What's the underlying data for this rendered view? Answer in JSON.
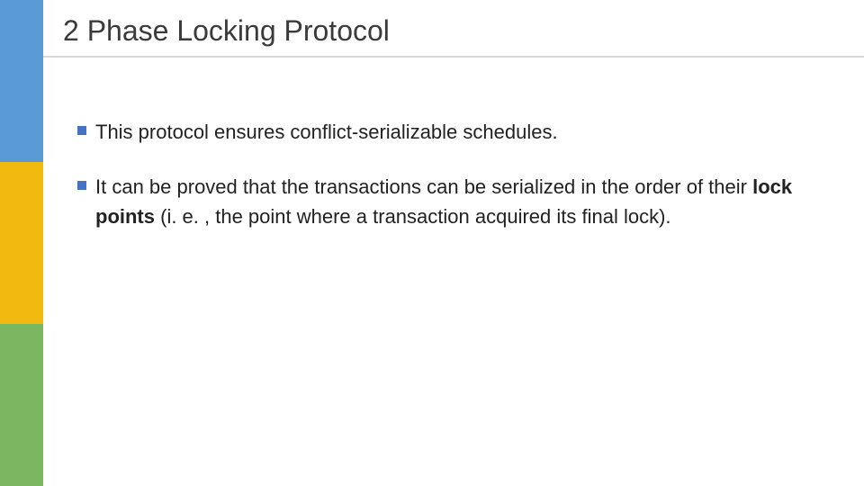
{
  "title": "2 Phase Locking Protocol",
  "bullets": {
    "b1": "This protocol ensures conflict-serializable schedules.",
    "b2_part1": "It can be proved that the transactions can be serialized in the order of their ",
    "b2_bold": "lock points",
    "b2_part2": "  (i. e. , the point where a transaction acquired its final lock)."
  },
  "colors": {
    "blue": "#5b9bd5",
    "yellow": "#f2b90e",
    "green": "#7bb661",
    "accent_square": "#4472c4"
  }
}
